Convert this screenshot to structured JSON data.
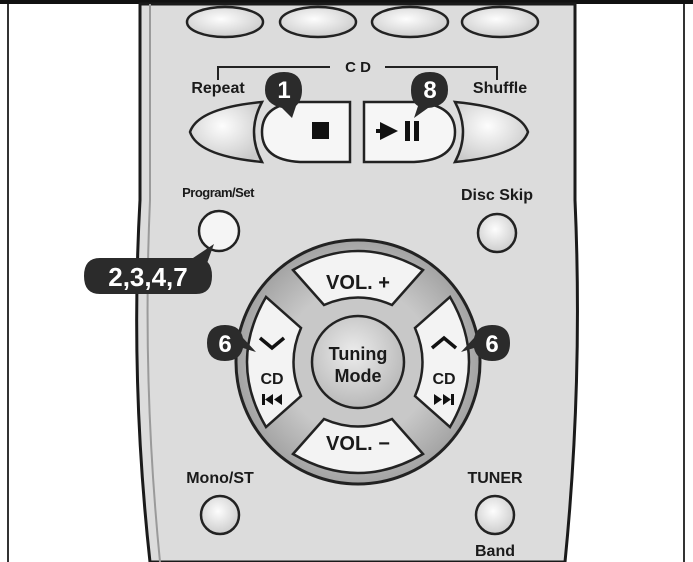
{
  "remote": {
    "cd_section_label": "C D",
    "repeat_label": "Repeat",
    "shuffle_label": "Shuffle",
    "program_set_label": "Program/Set",
    "disc_skip_label": "Disc Skip",
    "vol_plus_label": "VOL. +",
    "vol_minus_label": "VOL. −",
    "tuning_mode_line1": "Tuning",
    "tuning_mode_line2": "Mode",
    "cd_left_label": "CD",
    "cd_right_label": "CD",
    "mono_st_label": "Mono/ST",
    "tuner_label": "TUNER",
    "band_label": "Band"
  },
  "callouts": {
    "stop_step": "1",
    "play_step": "8",
    "program_steps": "2,3,4,7",
    "skip_left_step": "6",
    "skip_right_step": "6"
  },
  "icons": {
    "stop": "stop-square-icon",
    "play_pause": "play-pause-icon",
    "prev": "previous-track-icon",
    "next": "next-track-icon",
    "down": "chevron-down-icon",
    "up": "chevron-up-icon"
  },
  "colors": {
    "body_grey": "#d9d9d9",
    "outline": "#222222",
    "badge": "#2b2b2b",
    "button_light": "#f4f4f4"
  }
}
